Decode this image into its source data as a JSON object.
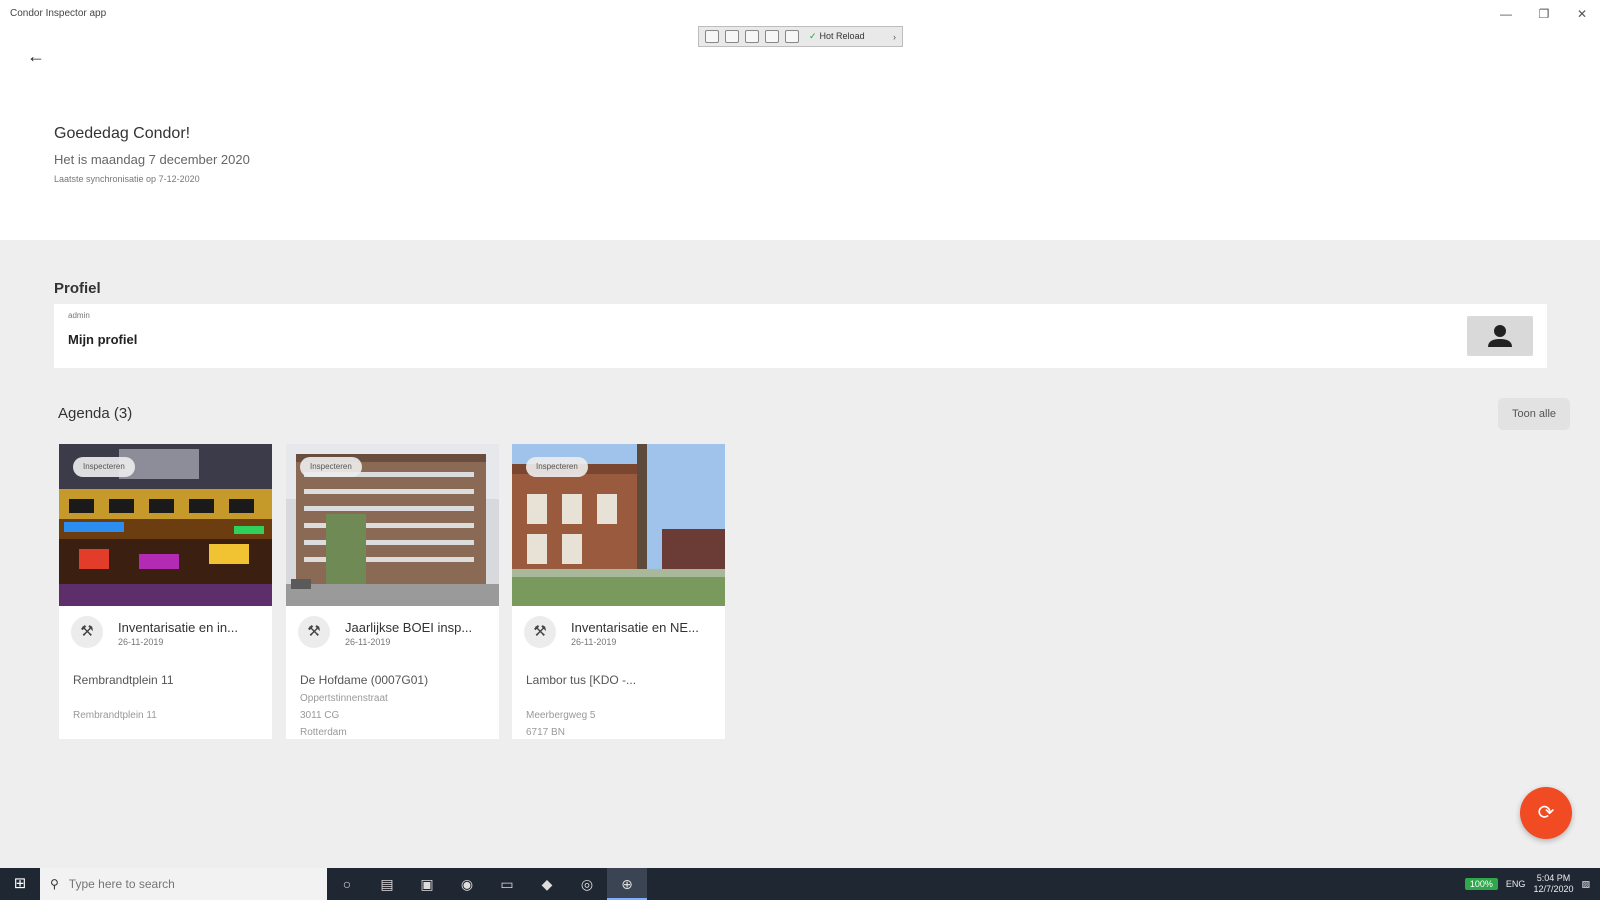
{
  "window": {
    "title": "Condor Inspector app",
    "min_symbol": "—",
    "max_symbol": "❐",
    "close_symbol": "✕"
  },
  "debug_toolbar": {
    "hot_reload_label": "Hot Reload",
    "check_symbol": "✓",
    "more_symbol": "›"
  },
  "nav": {
    "back_icon": "←"
  },
  "header": {
    "greeting": "Goededag Condor!",
    "date_line": "Het is maandag 7 december 2020",
    "sync_line": "Laatste synchronisatie op 7-12-2020"
  },
  "profile": {
    "section_title": "Profiel",
    "role": "admin",
    "name": "Mijn profiel"
  },
  "agenda": {
    "title": "Agenda (3)",
    "view_all": "Toon alle",
    "cards": [
      {
        "chip": "Inspecteren",
        "title": "Inventarisatie en in...",
        "date": "26-11-2019",
        "location": "Rembrandtplein 11",
        "sub": [
          "Rembrandtplein 11"
        ]
      },
      {
        "chip": "Inspecteren",
        "title": "Jaarlijkse BOEI insp...",
        "date": "26-11-2019",
        "location": "De Hofdame (0007G01)",
        "sub": [
          "Oppertstinnenstraat",
          "3011 CG",
          "Rotterdam"
        ]
      },
      {
        "chip": "Inspecteren",
        "title": "Inventarisatie en NE...",
        "date": "26-11-2019",
        "location": "Lambor tus  [KDO -...",
        "sub": [
          "Meerbergweg 5",
          "6717 BN"
        ]
      }
    ],
    "type_icon": "⚒"
  },
  "fab": {
    "icon": "⟳"
  },
  "taskbar": {
    "start_icon": "⊞",
    "search_icon": "⚲",
    "search_placeholder": "Type here to search",
    "apps": [
      "○",
      "▤",
      "▣",
      "◉",
      "▭",
      "◆",
      "◎",
      "⊕"
    ],
    "battery": "100%",
    "lang": "ENG",
    "time": "5:04 PM",
    "date": "12/7/2020",
    "notification_icon": "▨"
  },
  "colors": {
    "accent": "#f04b23",
    "content_bg": "#eeeeee",
    "taskbar_bg": "#1f2733"
  }
}
